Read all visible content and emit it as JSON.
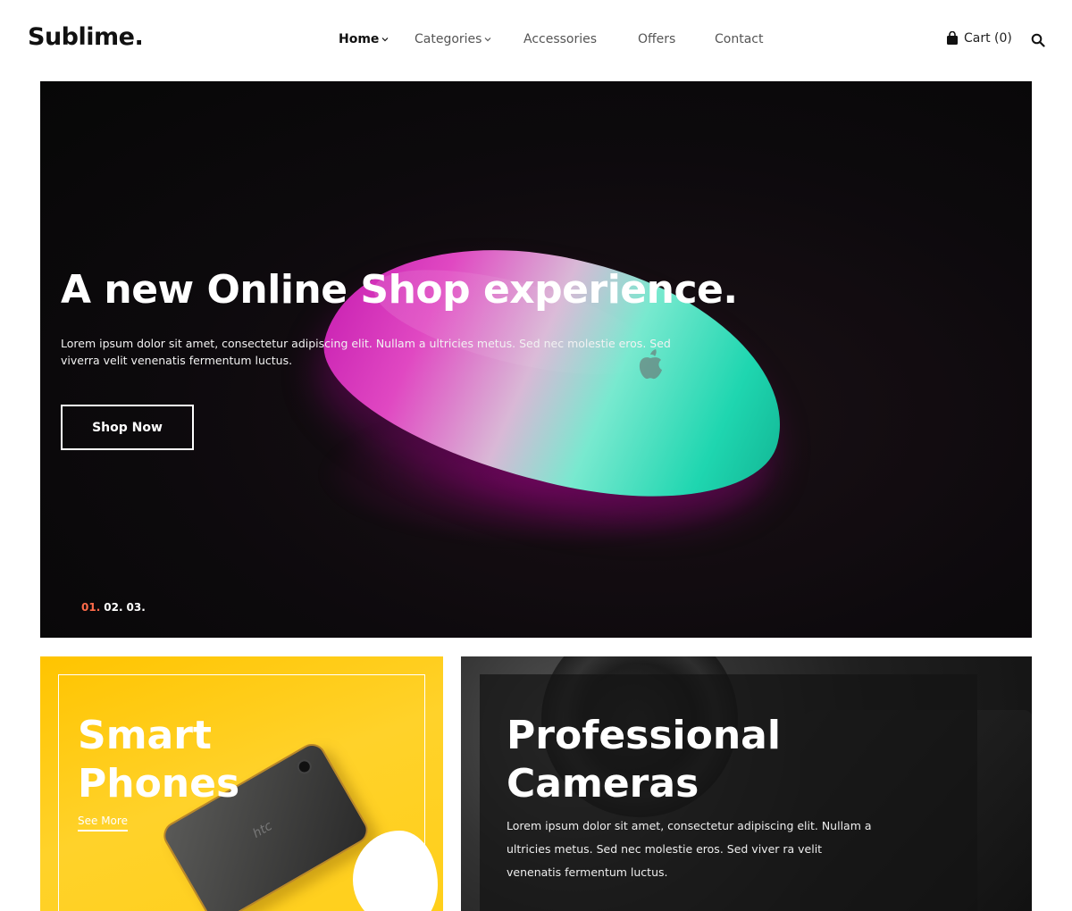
{
  "brand": {
    "logo": "Sublime."
  },
  "nav": {
    "items": [
      {
        "label": "Home",
        "has_dropdown": true,
        "active": true
      },
      {
        "label": "Categories",
        "has_dropdown": true,
        "active": false
      },
      {
        "label": "Accessories",
        "has_dropdown": false,
        "active": false
      },
      {
        "label": "Offers",
        "has_dropdown": false,
        "active": false
      },
      {
        "label": "Contact",
        "has_dropdown": false,
        "active": false
      }
    ]
  },
  "header": {
    "cart_label": "Cart (0)",
    "cart_icon": "shopping-bag-icon",
    "search_icon": "search-icon"
  },
  "hero": {
    "title": "A new Online Shop experience.",
    "description": "Lorem ipsum dolor sit amet, consectetur adipiscing elit. Nullam a ultricies metus. Sed nec molestie eros. Sed viverra velit venenatis fermentum luctus.",
    "cta_label": "Shop Now",
    "slides": [
      "01.",
      "02.",
      "03."
    ],
    "current_slide": 1
  },
  "promos": {
    "phones": {
      "title_line1": "Smart",
      "title_line2": "Phones",
      "link_label": "See More",
      "phone_brand": "htc"
    },
    "cameras": {
      "title_line1": "Professional",
      "title_line2": "Cameras",
      "description": "Lorem ipsum dolor sit amet, consectetur adipiscing elit. Nullam a ultricies metus. Sed nec molestie eros. Sed viver ra velit venenatis fermentum luctus."
    }
  },
  "colors": {
    "accent": "#ff6b4a",
    "phones_bg": "#ffc400",
    "text_dark": "#111111"
  }
}
